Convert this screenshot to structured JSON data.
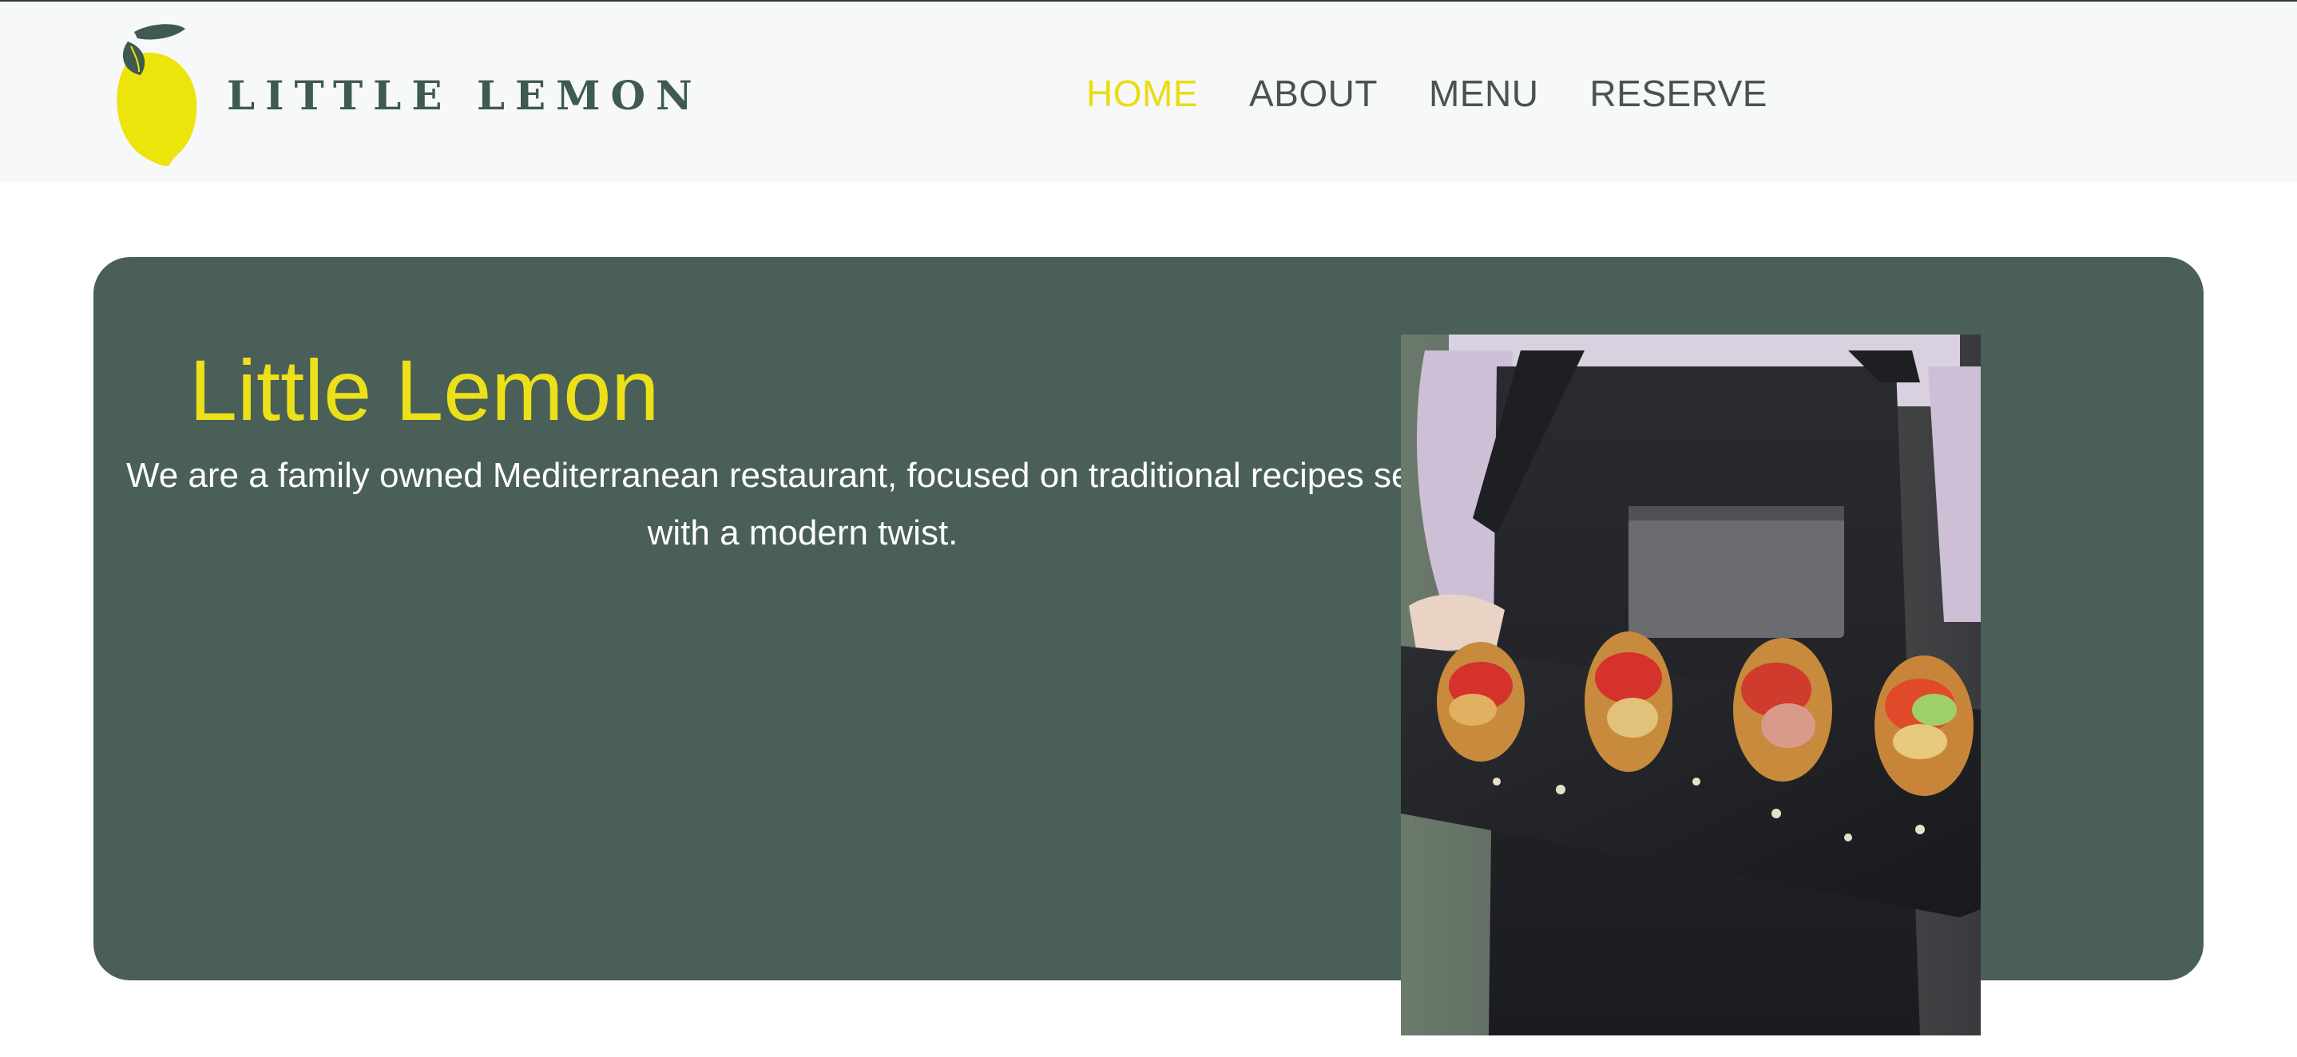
{
  "brand": {
    "name": "LITTLE LEMON",
    "logo_alt": "Little Lemon logo"
  },
  "nav": {
    "items": [
      {
        "label": "HOME",
        "active": true
      },
      {
        "label": "ABOUT",
        "active": false
      },
      {
        "label": "MENU",
        "active": false
      },
      {
        "label": "RESERVE",
        "active": false
      }
    ]
  },
  "hero": {
    "title": "Little Lemon",
    "description": "We are a family owned Mediterranean restaurant, focused on traditional recipes served with a modern twist.",
    "image_alt": "Chef holding a slate tray of bruschetta appetizers"
  },
  "colors": {
    "accent": "#ece019",
    "hero_bg": "#495f57",
    "nav_text": "#4a5352",
    "header_bg": "#f6f8f9"
  },
  "icons": [
    "lemon-logo-icon"
  ]
}
